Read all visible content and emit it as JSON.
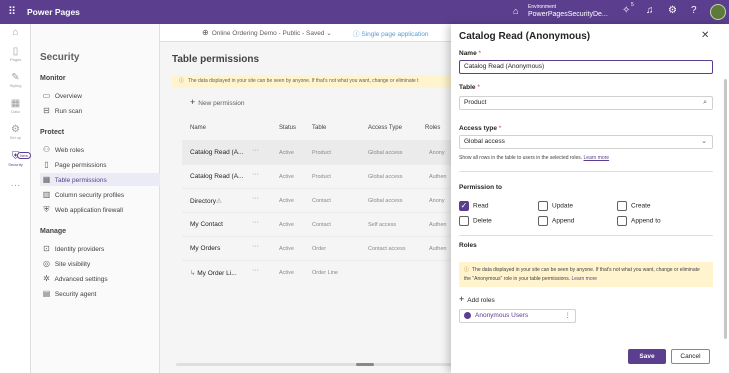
{
  "topbar": {
    "brand": "Power Pages",
    "environment_label": "Environment",
    "environment_name": "PowerPagesSecurityDe...",
    "notification_count": "5"
  },
  "rail": {
    "items": [
      {
        "label": "Pages"
      },
      {
        "label": "Styling"
      },
      {
        "label": "Data"
      },
      {
        "label": "Set up"
      },
      {
        "label": "Security"
      }
    ],
    "new_badge": "New"
  },
  "sidenav": {
    "title": "Security",
    "monitor": {
      "heading": "Monitor",
      "items": [
        "Overview",
        "Run scan"
      ]
    },
    "protect": {
      "heading": "Protect",
      "items": [
        "Web roles",
        "Page permissions",
        "Table permissions",
        "Column security profiles",
        "Web application firewall"
      ]
    },
    "manage": {
      "heading": "Manage",
      "items": [
        "Identity providers",
        "Site visibility",
        "Advanced settings",
        "Security agent"
      ]
    }
  },
  "header": {
    "site": "Online Ordering Demo - Public - Saved",
    "single_page_app": "Single page application"
  },
  "main": {
    "title": "Table permissions",
    "warning": "The data displayed in your site can be seen by anyone. If that's not what you want, change or eliminate t",
    "new_permission": "New permission",
    "columns": [
      "Name",
      "Status",
      "Table",
      "Access Type",
      "Roles"
    ],
    "rows": [
      {
        "name": "Catalog Read (A...",
        "status": "Active",
        "table": "Product",
        "access": "Global access",
        "roles": "Anony"
      },
      {
        "name": "Catalog Read (A...",
        "status": "Active",
        "table": "Product",
        "access": "Global access",
        "roles": "Authen"
      },
      {
        "name": "Directory",
        "status": "Active",
        "table": "Contact",
        "access": "Global access",
        "roles": "Anony"
      },
      {
        "name": "My Contact",
        "status": "Active",
        "table": "Contact",
        "access": "Self access",
        "roles": "Authen"
      },
      {
        "name": "My Orders",
        "status": "Active",
        "table": "Order",
        "access": "Contact access",
        "roles": "Authen"
      },
      {
        "name": "My Order Li...",
        "status": "Active",
        "table": "Order Line",
        "access": "",
        "roles": ""
      }
    ]
  },
  "panel": {
    "title": "Catalog Read (Anonymous)",
    "name_label": "Name",
    "name_value": "Catalog Read (Anonymous)",
    "table_label": "Table",
    "table_value": "Product",
    "access_type_label": "Access type",
    "access_type_value": "Global access",
    "access_help": "Show all rows in the table to users in the selected roles.",
    "access_help_link": "Learn more",
    "permission_to_label": "Permission to",
    "permissions": [
      {
        "label": "Read",
        "checked": true
      },
      {
        "label": "Update",
        "checked": false
      },
      {
        "label": "Create",
        "checked": false
      },
      {
        "label": "Delete",
        "checked": false
      },
      {
        "label": "Append",
        "checked": false
      },
      {
        "label": "Append to",
        "checked": false
      }
    ],
    "roles_label": "Roles",
    "roles_warning": "The data displayed in your site can be seen by anyone. If that's not what you want, change or eliminate the \"Anonymous\" role in your table permissions.",
    "roles_warning_link": "Learn more",
    "add_roles": "Add roles",
    "role_chip": "Anonymous Users",
    "save": "Save",
    "cancel": "Cancel"
  },
  "colors": {
    "accent": "#5b3f8e",
    "warning_bg": "#fff4ce"
  }
}
